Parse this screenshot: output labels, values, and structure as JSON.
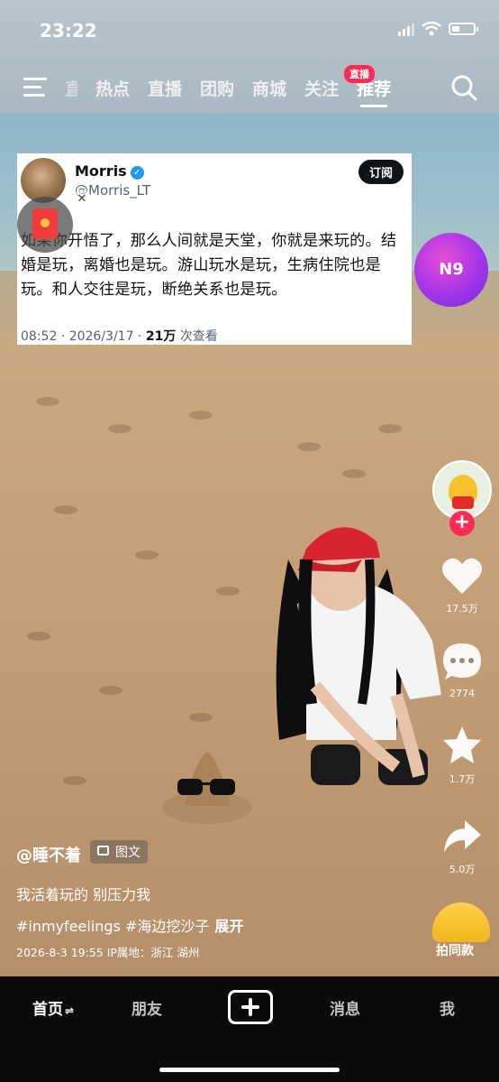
{
  "status_bar": {
    "time": "23:22"
  },
  "top_nav": {
    "tabs": [
      {
        "label": "直播",
        "partial": true
      },
      {
        "label": "热点"
      },
      {
        "label": "直播"
      },
      {
        "label": "团购"
      },
      {
        "label": "商城"
      },
      {
        "label": "关注"
      },
      {
        "label": "推荐",
        "active": true
      }
    ],
    "live_badge": "直播"
  },
  "tweet_card": {
    "author_name": "Morris",
    "handle": "@Morris_LT",
    "subscribe_label": "订阅",
    "body": "如果你开悟了，那么人间就是天堂，你就是来玩的。结婚是玩，离婚也是玩。游山玩水是玩，生病住院也是玩。和人交往是玩，断绝关系也是玩。",
    "time": "08:52 · 2026/3/17 · ",
    "views_count": "21万",
    "views_label": " 次查看"
  },
  "overlay": {
    "close_symbol": "✕",
    "badge_text": "N9"
  },
  "right_rail": {
    "likes": "17.5万",
    "comments": "2774",
    "favorites": "1.7万",
    "shares": "5.0万",
    "music_label": "拍同款",
    "follow_symbol": "+"
  },
  "caption": {
    "author": "@睡不着",
    "type_pill": "图文",
    "text": "我活着玩的 别压力我",
    "tags": "#inmyfeelings #海边挖沙子",
    "expand": "展开",
    "dateline": "2026-8-3 19:55  IP属地：浙江 湖州"
  },
  "bottom_nav": {
    "home": "首页",
    "home_suffix": "⇌",
    "friends": "朋友",
    "messages": "消息",
    "me": "我"
  },
  "colors": {
    "accent": "#fe2c55",
    "verified": "#1d9bf0",
    "bar": "#0b0b0b"
  }
}
